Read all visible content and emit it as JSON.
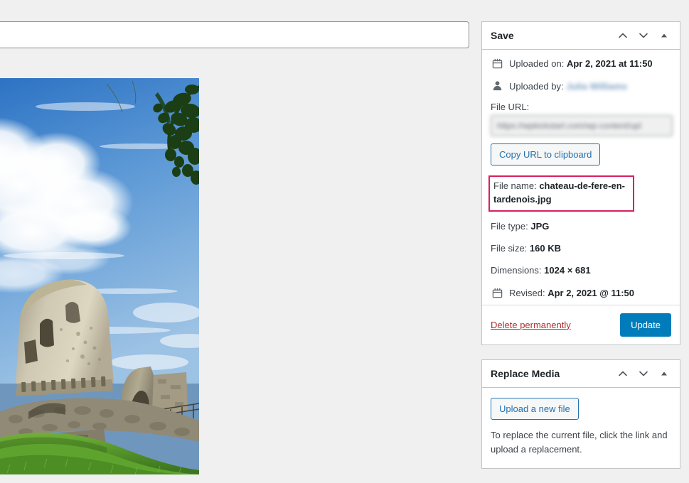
{
  "editor": {
    "title_field_value": "",
    "title_field_placeholder": ""
  },
  "attachment_preview": {
    "alt": "Photograph of the ruined Chateau de Fere-en-Tardenois tower on a grassy hill under a blue sky with white clouds"
  },
  "save_panel": {
    "title": "Save",
    "move_up_icon": "chevron-up-icon",
    "move_down_icon": "chevron-down-icon",
    "toggle_icon": "triangle-up-icon",
    "uploaded_on": {
      "icon": "calendar-icon",
      "label": "Uploaded on:",
      "value": "Apr 2, 2021 at 11:50"
    },
    "uploaded_by": {
      "icon": "user-icon",
      "label": "Uploaded by:",
      "value": "Julia Williams"
    },
    "file_url": {
      "label": "File URL:",
      "value": "https://wpkickstart.com/wp-content/upl",
      "copy_button_label": "Copy URL to clipboard"
    },
    "file_name": {
      "label": "File name:",
      "value": "chateau-de-fere-en-tardenois.jpg",
      "highlight_color": "#d6215f"
    },
    "file_type": {
      "label": "File type:",
      "value": "JPG"
    },
    "file_size": {
      "label": "File size:",
      "value": "160 KB"
    },
    "dimensions": {
      "label": "Dimensions:",
      "value": "1024 × 681"
    },
    "revised": {
      "icon": "calendar-icon",
      "label": "Revised:",
      "value": "Apr 2, 2021 @ 11:50"
    },
    "delete_link_label": "Delete permanently",
    "update_button_label": "Update",
    "update_button_color": "#007cba",
    "delete_link_color": "#b32d2e"
  },
  "replace_media_panel": {
    "title": "Replace Media",
    "move_up_icon": "chevron-up-icon",
    "move_down_icon": "chevron-down-icon",
    "toggle_icon": "triangle-up-icon",
    "upload_button_label": "Upload a new file",
    "help_text": "To replace the current file, click the link and upload a replacement."
  }
}
